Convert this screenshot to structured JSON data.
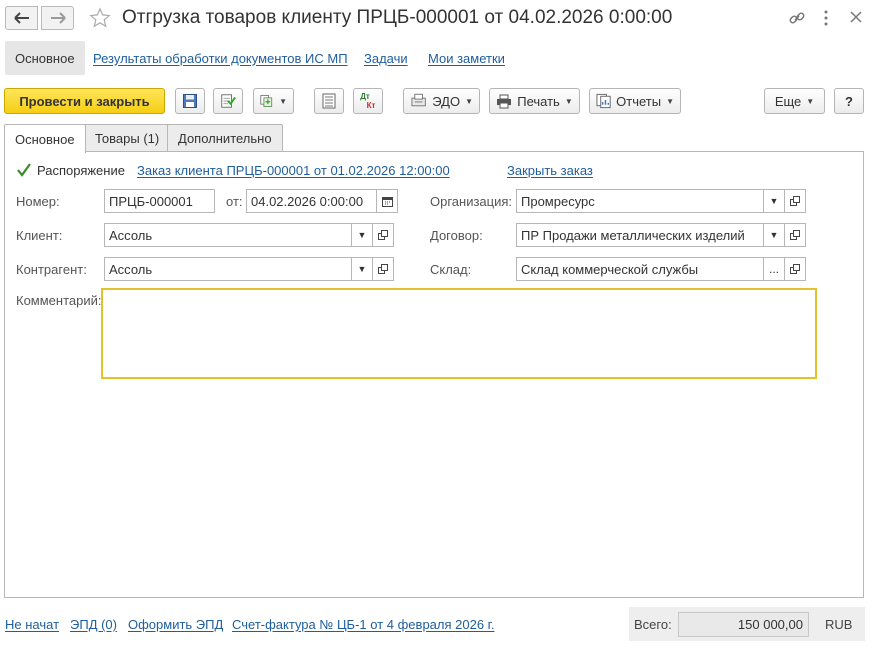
{
  "window": {
    "title": "Отгрузка товаров клиенту ПРЦБ-000001 от 04.02.2026 0:00:00"
  },
  "sections": [
    {
      "label": "Основное"
    },
    {
      "label": "Результаты обработки документов ИС МП"
    },
    {
      "label": "Задачи"
    },
    {
      "label": "Мои заметки"
    }
  ],
  "toolbar": {
    "post_close_label": "Провести и закрыть",
    "edo_label": "ЭДО",
    "print_label": "Печать",
    "reports_label": "Отчеты",
    "more_label": "Еще",
    "help_label": "?",
    "dtkt_top": "Дт",
    "dtkt_bottom": "Кт"
  },
  "tabs": [
    {
      "label": "Основное"
    },
    {
      "label": "Товары (1)"
    },
    {
      "label": "Дополнительно"
    }
  ],
  "form": {
    "order_checkbox_label": "Распоряжение",
    "order_link": "Заказ клиента ПРЦБ-000001 от 01.02.2026 12:00:00",
    "close_order_link": "Закрыть заказ",
    "number_label": "Номер:",
    "number_value": "ПРЦБ-000001",
    "date_label": "от:",
    "date_value": "04.02.2026  0:00:00",
    "org_label": "Организация:",
    "org_value": "Промресурс",
    "client_label": "Клиент:",
    "client_value": "Ассоль",
    "contract_label": "Договор:",
    "contract_value": "ПР Продажи металлических изделий",
    "counterparty_label": "Контрагент:",
    "counterparty_value": "Ассоль",
    "warehouse_label": "Склад:",
    "warehouse_value": "Склад коммерческой службы",
    "comment_label": "Комментарий:",
    "comment_value": ""
  },
  "footer": {
    "status_link": "Не начат",
    "epd_link": "ЭПД (0)",
    "make_epd_link": "Оформить ЭПД",
    "invoice_link": "Счет-фактура № ЦБ-1 от 4 февраля 2026 г.",
    "total_label": "Всего:",
    "total_value": "150 000,00",
    "currency": "RUB"
  },
  "colors": {
    "accent_yellow": "#f5cf12",
    "link_blue": "#1f5e9c",
    "check_green": "#3c8b2a",
    "comment_border": "#e5c22a"
  }
}
